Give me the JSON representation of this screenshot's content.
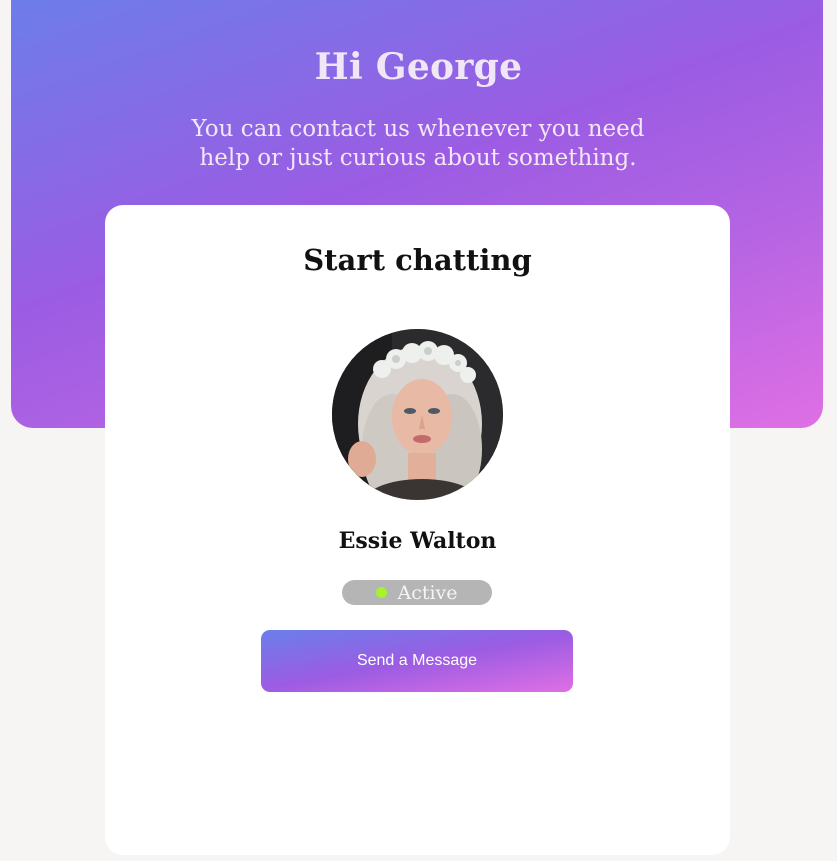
{
  "header": {
    "greeting": "Hi George",
    "subtitle": "You can contact us whenever you need help or just curious about something."
  },
  "card": {
    "title": "Start chatting",
    "contact": {
      "name": "Essie Walton",
      "avatar_icon": "avatar-photo",
      "status": "Active",
      "status_color": "#a6f22c"
    },
    "send_button_label": "Send a Message"
  },
  "colors": {
    "gradient_start": "#6a7fea",
    "gradient_mid": "#9b5ce3",
    "gradient_end": "#df6fe4",
    "page_background": "#f6f5f4",
    "status_pill": "#b5b5b5"
  }
}
